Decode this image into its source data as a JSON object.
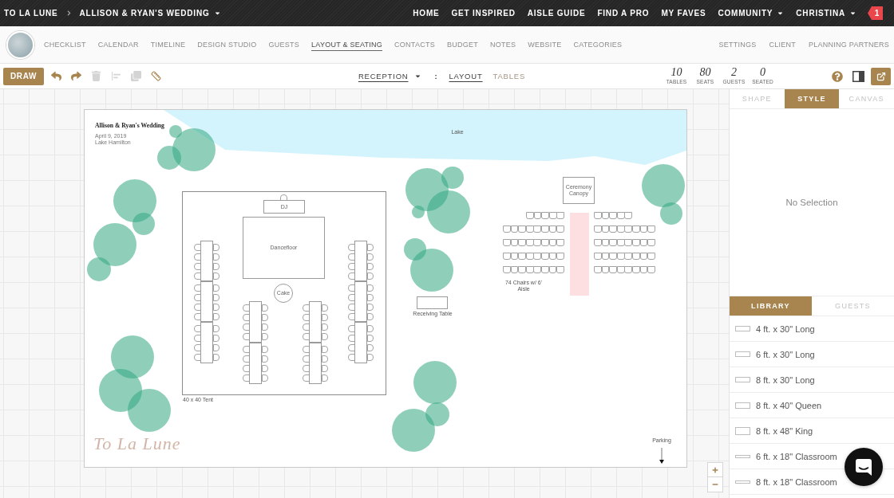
{
  "top_bar": {
    "brand": "TO LA LUNE",
    "event": "ALLISON & RYAN'S WEDDING",
    "links": [
      {
        "label": "HOME",
        "dropdown": false
      },
      {
        "label": "GET INSPIRED",
        "dropdown": false
      },
      {
        "label": "AISLE GUIDE",
        "dropdown": false
      },
      {
        "label": "FIND A PRO",
        "dropdown": false
      },
      {
        "label": "MY FAVES",
        "dropdown": false
      },
      {
        "label": "COMMUNITY",
        "dropdown": true
      },
      {
        "label": "CHRISTINA",
        "dropdown": true
      }
    ],
    "notifications": "1"
  },
  "nav": {
    "items": [
      {
        "label": "CHECKLIST",
        "selected": false
      },
      {
        "label": "CALENDAR",
        "selected": false
      },
      {
        "label": "TIMELINE",
        "selected": false
      },
      {
        "label": "DESIGN STUDIO",
        "selected": false
      },
      {
        "label": "GUESTS",
        "selected": false
      },
      {
        "label": "LAYOUT & SEATING",
        "selected": true
      },
      {
        "label": "CONTACTS",
        "selected": false
      },
      {
        "label": "BUDGET",
        "selected": false
      },
      {
        "label": "NOTES",
        "selected": false
      },
      {
        "label": "WEBSITE",
        "selected": false
      },
      {
        "label": "CATEGORIES",
        "selected": false
      }
    ],
    "right_items": [
      "SETTINGS",
      "CLIENT",
      "PLANNING PARTNERS"
    ]
  },
  "toolbar": {
    "draw": "DRAW",
    "tools": [
      {
        "kind": "undo",
        "disabled": false
      },
      {
        "kind": "redo",
        "disabled": false
      },
      {
        "kind": "delete",
        "disabled": true
      },
      {
        "kind": "align",
        "disabled": true
      },
      {
        "kind": "duplicate",
        "disabled": true
      },
      {
        "kind": "measure",
        "disabled": false
      }
    ],
    "room": "RECEPTION",
    "separator": ":",
    "views": [
      {
        "label": "LAYOUT",
        "selected": true
      },
      {
        "label": "TABLES",
        "selected": false
      }
    ],
    "stats": [
      {
        "value": "10",
        "label": "TABLES"
      },
      {
        "value": "80",
        "label": "SEATS"
      },
      {
        "value": "2",
        "label": "GUESTS"
      },
      {
        "value": "0",
        "label": "SEATED"
      }
    ]
  },
  "canvas": {
    "title": "Allison & Ryan's Wedding",
    "date": "April 9, 2019",
    "venue": "Lake Hamilton",
    "lake": "Lake",
    "dj": "DJ",
    "dance_floor": "Dancefloor",
    "cake": "Cake",
    "tent": "40 x 40 Tent",
    "receiving_table": "Receiving Table",
    "canopy": "Ceremony Canopy",
    "ceremony_seating": "74 Chairs w/ 6' Aisle",
    "parking": "Parking",
    "logo": "To La Lune"
  },
  "inspector": {
    "tabs": [
      {
        "label": "SHAPE",
        "selected": false
      },
      {
        "label": "STYLE",
        "selected": true
      },
      {
        "label": "CANVAS",
        "selected": false
      }
    ],
    "message": "No Selection"
  },
  "library": {
    "tabs": [
      {
        "label": "LIBRARY",
        "selected": true
      },
      {
        "label": "GUESTS",
        "selected": false
      }
    ],
    "items": [
      {
        "label": "4 ft. x 30\" Long",
        "kind": "long"
      },
      {
        "label": "6 ft. x 30\" Long",
        "kind": "long"
      },
      {
        "label": "8 ft. x 30\" Long",
        "kind": "long"
      },
      {
        "label": "8 ft. x 40\" Queen",
        "kind": "queen"
      },
      {
        "label": "8 ft. x 48\" King",
        "kind": "king"
      },
      {
        "label": "6 ft. x 18\" Classroom",
        "kind": "classroom"
      },
      {
        "label": "8 ft. x 18\" Classroom",
        "kind": "classroom"
      }
    ]
  }
}
